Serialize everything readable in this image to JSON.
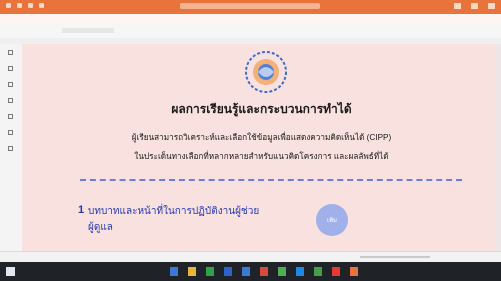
{
  "window": {
    "title": ""
  },
  "menubar": {
    "items": [
      "",
      "",
      "",
      "",
      "",
      "",
      "",
      "",
      "",
      ""
    ]
  },
  "document": {
    "heading": "ผลการเรียนรู้และกระบวนการทำได้",
    "subtitle_line1": "ผู้เรียนสามารถวิเคราะห์และเลือกใช้ข้อมูลเพื่อแสดงความคิดเห็นได้ (CIPP)",
    "subtitle_line2": "ในประเด็นทางเลือกที่หลากหลายสำหรับแนวคิดโครงการ และผลลัพธ์ที่ได้",
    "item_number": "1",
    "item_text": "บทบาทและหน้าที่ในการปฏิบัติงานผู้ช่วย",
    "item_text_line2": "ผู้ดูแล",
    "circle_label": "เพิ่ม"
  },
  "statusbar": {
    "page": "",
    "zoom": ""
  },
  "taskbar": {
    "search": "",
    "time": "",
    "date": ""
  },
  "colors": {
    "titlebar": "#e8743b",
    "page": "#f9e1e0",
    "accent": "#2338b6",
    "divider": "#6a7ee3"
  },
  "icons": [
    "logo-icon",
    "windows-start-icon",
    "search-icon",
    "edge-icon",
    "folder-icon",
    "word-icon"
  ]
}
